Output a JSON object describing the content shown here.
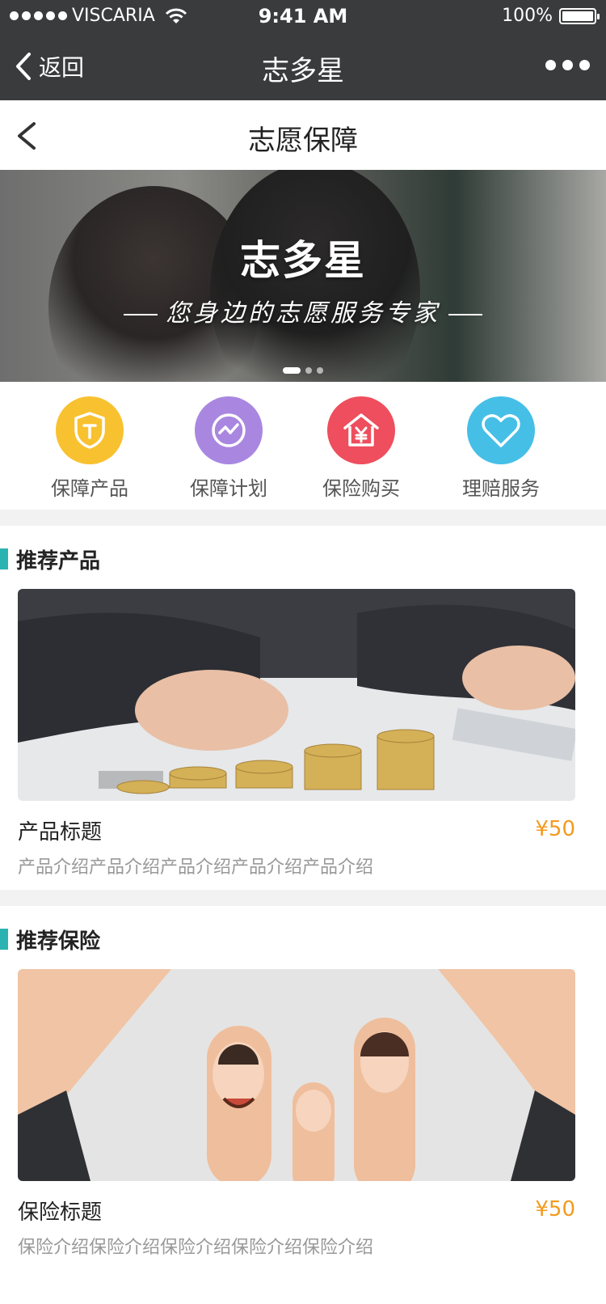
{
  "status_bar": {
    "carrier": "VISCARIA",
    "time": "9:41 AM",
    "battery": "100%"
  },
  "app_bar": {
    "back_label": "返回",
    "title": "志多星"
  },
  "sub_header": {
    "title": "志愿保障"
  },
  "banner": {
    "title": "志多星",
    "subtitle": "您身边的志愿服务专家",
    "slide_count": 3,
    "active_slide": 1
  },
  "quick_actions": [
    {
      "label": "保障产品",
      "icon": "shield-icon",
      "color": "#f8c12f"
    },
    {
      "label": "保障计划",
      "icon": "trend-circle-icon",
      "color": "#a987e0"
    },
    {
      "label": "保险购买",
      "icon": "house-yen-icon",
      "color": "#ee4e5d"
    },
    {
      "label": "理赔服务",
      "icon": "heart-icon",
      "color": "#46bfe7"
    }
  ],
  "sections": [
    {
      "heading": "推荐产品",
      "card": {
        "title": "产品标题",
        "price": "¥50",
        "description": "产品介绍产品介绍产品介绍产品介绍产品介绍"
      }
    },
    {
      "heading": "推荐保险",
      "card": {
        "title": "保险标题",
        "price": "¥50",
        "description": "保险介绍保险介绍保险介绍保险介绍保险介绍"
      }
    }
  ],
  "accent_color": "#2bb3b1",
  "price_color": "#f39a1e"
}
